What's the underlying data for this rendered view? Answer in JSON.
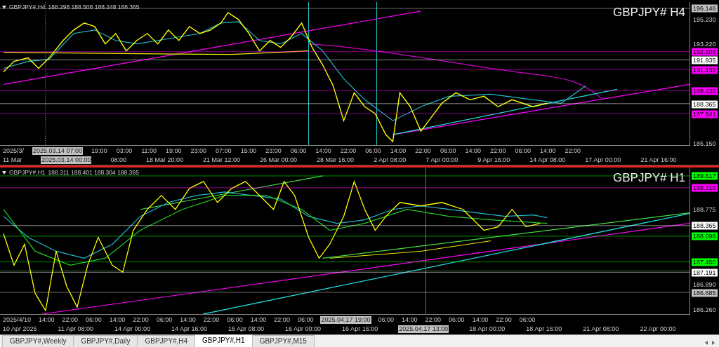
{
  "panels": [
    {
      "header": {
        "symbol": "GBPJPY#,H4",
        "prices": "188.298 188.508 188.248 188.365"
      },
      "title": "GBPJPY#  H4",
      "price_labels": [
        {
          "text": "196.146",
          "kind": "tag",
          "color": "#c0c0c0"
        },
        {
          "text": "195.230",
          "kind": "tick"
        },
        {
          "text": "193.220",
          "kind": "tick"
        },
        {
          "text": "192.608",
          "kind": "tag",
          "color": "#ff00ff"
        },
        {
          "text": "191.935",
          "kind": "tag",
          "color": "#ffffff"
        },
        {
          "text": "191.159",
          "kind": "tag",
          "color": "#ff00ff"
        },
        {
          "text": "189.430",
          "kind": "tag",
          "color": "#ff00ff"
        },
        {
          "text": "188.365",
          "kind": "tag",
          "color": "#ffffff"
        },
        {
          "text": "187.541",
          "kind": "tag",
          "color": "#ff00ff"
        },
        {
          "text": "185.150",
          "kind": "tick"
        }
      ],
      "time_row_1": [
        {
          "text": "2025/3/",
          "kind": "text"
        },
        {
          "text": "2025.03.14 07:00",
          "kind": "tag"
        },
        {
          "text": "19:00",
          "kind": "text"
        },
        {
          "text": "03:00",
          "kind": "text"
        },
        {
          "text": "11:00",
          "kind": "text"
        },
        {
          "text": "19:00",
          "kind": "text"
        },
        {
          "text": "23:00",
          "kind": "text"
        },
        {
          "text": "07:00",
          "kind": "text"
        },
        {
          "text": "15:00",
          "kind": "text"
        },
        {
          "text": "23:00",
          "kind": "text"
        },
        {
          "text": "06:00",
          "kind": "text"
        },
        {
          "text": "14:00",
          "kind": "text"
        },
        {
          "text": "22:00",
          "kind": "text"
        },
        {
          "text": "06:00",
          "kind": "text"
        },
        {
          "text": "14:00",
          "kind": "text"
        },
        {
          "text": "22:00",
          "kind": "text"
        },
        {
          "text": "06:00",
          "kind": "text"
        },
        {
          "text": "14:00",
          "kind": "text"
        },
        {
          "text": "22:00",
          "kind": "text"
        },
        {
          "text": "06:00",
          "kind": "text"
        },
        {
          "text": "14:00",
          "kind": "text"
        },
        {
          "text": "22:00",
          "kind": "text"
        }
      ],
      "time_row_2": [
        {
          "text": "11 Mar",
          "kind": "text"
        },
        {
          "text": "2025.03.14 00:00",
          "kind": "tag"
        },
        {
          "text": "08:00",
          "kind": "text"
        },
        {
          "text": "18 Mar 20:00",
          "kind": "text"
        },
        {
          "text": "21 Mar 12:00",
          "kind": "text"
        },
        {
          "text": "26 Mar 00:00",
          "kind": "text"
        },
        {
          "text": "28 Mar 16:00",
          "kind": "text"
        },
        {
          "text": "2 Apr 08:00",
          "kind": "text"
        },
        {
          "text": "7 Apr 00:00",
          "kind": "text"
        },
        {
          "text": "9 Apr 16:00",
          "kind": "text"
        },
        {
          "text": "14 Apr 08:00",
          "kind": "text"
        },
        {
          "text": "17 Apr 00:00",
          "kind": "text"
        },
        {
          "text": "21 Apr 16:00",
          "kind": "text"
        }
      ]
    },
    {
      "header": {
        "symbol": "GBPJPY#,H1",
        "prices": "188.311 188.401 188.304 188.365"
      },
      "title": "GBPJPY#  H1",
      "price_labels": [
        {
          "text": "189.617",
          "kind": "tag",
          "color": "#00ff00"
        },
        {
          "text": "189.319",
          "kind": "tag",
          "color": "#ff00ff"
        },
        {
          "text": "188.775",
          "kind": "tick"
        },
        {
          "text": "188.365",
          "kind": "tag",
          "color": "#ffffff"
        },
        {
          "text": "188.098",
          "kind": "tag",
          "color": "#00ff00"
        },
        {
          "text": "187.450",
          "kind": "tag",
          "color": "#00ff00"
        },
        {
          "text": "187.191",
          "kind": "tag",
          "color": "#ffffff"
        },
        {
          "text": "186.890",
          "kind": "tick"
        },
        {
          "text": "186.685",
          "kind": "tag",
          "color": "#c0c0c0"
        },
        {
          "text": "186.260",
          "kind": "tick"
        }
      ],
      "time_row_1": [
        {
          "text": "2025/4/10",
          "kind": "text"
        },
        {
          "text": "14:00",
          "kind": "text"
        },
        {
          "text": "22:00",
          "kind": "text"
        },
        {
          "text": "06:00",
          "kind": "text"
        },
        {
          "text": "14:00",
          "kind": "text"
        },
        {
          "text": "22:00",
          "kind": "text"
        },
        {
          "text": "06:00",
          "kind": "text"
        },
        {
          "text": "14:00",
          "kind": "text"
        },
        {
          "text": "22:00",
          "kind": "text"
        },
        {
          "text": "06:00",
          "kind": "text"
        },
        {
          "text": "14:00",
          "kind": "text"
        },
        {
          "text": "22:00",
          "kind": "text"
        },
        {
          "text": "06:00",
          "kind": "text"
        },
        {
          "text": "2025.04.17 19:00",
          "kind": "tag"
        },
        {
          "text": "06:00",
          "kind": "text"
        },
        {
          "text": "14:00",
          "kind": "text"
        },
        {
          "text": "22:00",
          "kind": "text"
        },
        {
          "text": "06:00",
          "kind": "text"
        },
        {
          "text": "14:00",
          "kind": "text"
        },
        {
          "text": "22:00",
          "kind": "text"
        },
        {
          "text": "06:00",
          "kind": "text"
        }
      ],
      "time_row_2": [
        {
          "text": "10 Apr 2025",
          "kind": "text"
        },
        {
          "text": "11 Apr 08:00",
          "kind": "text"
        },
        {
          "text": "14 Apr 00:00",
          "kind": "text"
        },
        {
          "text": "14 Apr 16:00",
          "kind": "text"
        },
        {
          "text": "15 Apr 08:00",
          "kind": "text"
        },
        {
          "text": "16 Apr 00:00",
          "kind": "text"
        },
        {
          "text": "16 Apr 16:00",
          "kind": "text"
        },
        {
          "text": "2025.04.17 13:00",
          "kind": "tag"
        },
        {
          "text": "18 Apr 00:00",
          "kind": "text"
        },
        {
          "text": "18 Apr 16:00",
          "kind": "text"
        },
        {
          "text": "21 Apr 08:00",
          "kind": "text"
        },
        {
          "text": "22 Apr 00:00",
          "kind": "text"
        }
      ]
    }
  ],
  "tabs": [
    {
      "label": "GBPJPY#,Weekly",
      "selected": false
    },
    {
      "label": "GBPJPY#,Daily",
      "selected": false
    },
    {
      "label": "GBPJPY#,H4",
      "selected": false
    },
    {
      "label": "GBPJPY#,H1",
      "selected": true
    },
    {
      "label": "GBPJPY#,M15",
      "selected": false
    }
  ]
}
